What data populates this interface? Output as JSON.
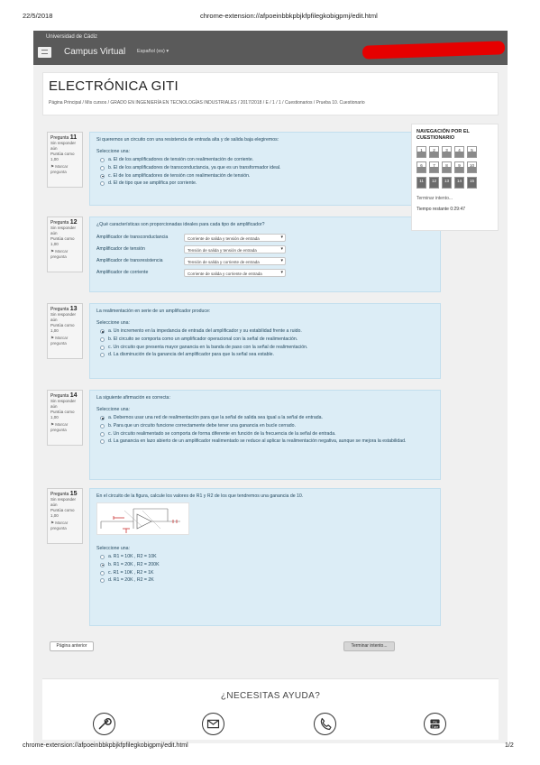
{
  "print_header": {
    "date": "22/5/2018",
    "url": "chrome-extension://afpoeinbbkpbjkfpfilegkobigpmj/edit.html"
  },
  "navbar": {
    "brand": "Universidad de Cádiz",
    "site_name": "Campus Virtual",
    "language": "Español (es)"
  },
  "course": {
    "title": "ELECTRÓNICA GITI",
    "breadcrumb": "Página Principal / Mis cursos / GRADO EN INGENIERÍA EN TECNOLOGÍAS INDUSTRIALES / 2017/2018 / E / 1 / 1 / Cuestionarios / Prueba 10. Cuestionario"
  },
  "questions": [
    {
      "label": "Pregunta",
      "number": "11",
      "status": "Sin responder aún",
      "points": "Puntúa como 1,00",
      "flag": "Marcar pregunta",
      "text": "Si queremos un circuito con una resistencia de entrada alta y de salida baja elegiremos:",
      "select_label": "Seleccione una:",
      "options": [
        {
          "text": "a. El de los amplificadores de tensión con realimentación de corriente.",
          "selected": false
        },
        {
          "text": "b. El de los amplificadores de transconductancia, ya que es un transformador ideal.",
          "selected": false
        },
        {
          "text": "c. El de los amplificadores de tensión con realimentación de tensión.",
          "selected": true
        },
        {
          "text": "d. El de tipo que se amplifica por corriente.",
          "selected": false
        }
      ]
    },
    {
      "label": "Pregunta",
      "number": "12",
      "status": "Sin responder aún",
      "points": "Puntúa como 1,00",
      "flag": "Marcar pregunta",
      "text": "¿Qué características son proporcionadas ideales para cada tipo de amplificador?",
      "matches": [
        {
          "label": "Amplificador de transconductancia",
          "value": "Corriente de salida y tensión de entrada"
        },
        {
          "label": "Amplificador de tensión",
          "value": "Tensión de salida y tensión de entrada"
        },
        {
          "label": "Amplificador de transresistencia",
          "value": "Tensión de salida y corriente de entrada"
        },
        {
          "label": "Amplificador de corriente",
          "value": "Corriente de salida y corriente de entrada"
        }
      ]
    },
    {
      "label": "Pregunta",
      "number": "13",
      "status": "Sin responder aún",
      "points": "Puntúa como 1,00",
      "flag": "Marcar pregunta",
      "text": "La realimentación en serie de un amplificador produce:",
      "select_label": "Seleccione una:",
      "options": [
        {
          "text": "a. Un incremento en la impedancia de entrada del amplificador y su estabilidad frente a ruido.",
          "selected": true
        },
        {
          "text": "b. El circuito se comporta como un amplificador operacional con la señal de realimentación.",
          "selected": false
        },
        {
          "text": "c. Un circuito que presenta mayor ganancia en la banda de paso con la señal de realimentación.",
          "selected": false
        },
        {
          "text": "d. La disminución de la ganancia del amplificador para que la señal sea estable.",
          "selected": false
        }
      ]
    },
    {
      "label": "Pregunta",
      "number": "14",
      "status": "Sin responder aún",
      "points": "Puntúa como 1,00",
      "flag": "Marcar pregunta",
      "text": "La siguiente afirmación es correcta:",
      "select_label": "Seleccione una:",
      "options": [
        {
          "text": "a. Debemos usar una red de realimentación para que la señal de salida sea igual a la señal de entrada.",
          "selected": true
        },
        {
          "text": "b. Para que un circuito funcione correctamente debe tener una ganancia en bucle cerrado.",
          "selected": false
        },
        {
          "text": "c. Un circuito realimentado se comporta de forma diferente en función de la frecuencia de la señal de entrada.",
          "selected": false
        },
        {
          "text": "d. La ganancia en lazo abierto de un amplificador realimentado se reduce al aplicar la realimentación negativa, aunque se mejora la estabilidad.",
          "selected": false
        }
      ]
    },
    {
      "label": "Pregunta",
      "number": "15",
      "status": "Sin responder aún",
      "points": "Puntúa como 1,00",
      "flag": "Marcar pregunta",
      "text": "En el circuito de la figura, calcule los valores de R1 y R2 de los que tendremos una ganancia de 10.",
      "select_label": "Seleccione una:",
      "options": [
        {
          "text": "a. R1 = 10K , R2 = 10K",
          "selected": false
        },
        {
          "text": "b. R1 = 20K , R2 = 200K",
          "selected": true
        },
        {
          "text": "c. R1 = 10K , R2 = 1K",
          "selected": false
        },
        {
          "text": "d. R1 = 20K , R2 = 2K",
          "selected": false
        }
      ]
    }
  ],
  "quiz_nav": {
    "title": "NAVEGACIÓN POR EL CUESTIONARIO",
    "cells": [
      "1",
      "2",
      "3",
      "4",
      "5",
      "6",
      "7",
      "8",
      "9",
      "10",
      "11",
      "12",
      "13",
      "14",
      "15"
    ],
    "finish_link": "Terminar intento...",
    "timer": "Tiempo restante 0:29:47"
  },
  "buttons": {
    "prev": "Página anterior",
    "finish": "Terminar intento..."
  },
  "help": {
    "title": "¿NECESITAS AYUDA?",
    "icons": [
      "wrench-icon",
      "envelope-icon",
      "phone-icon",
      "youtube-icon"
    ]
  },
  "print_footer": {
    "url": "chrome-extension://afpoeinbbkpbjkfpfilegkobigpmj/edit.html",
    "page": "1/2"
  },
  "colors": {
    "navbar": "#5a5a5a",
    "question_bg": "#dcedf6",
    "redaction": "#e60000"
  }
}
